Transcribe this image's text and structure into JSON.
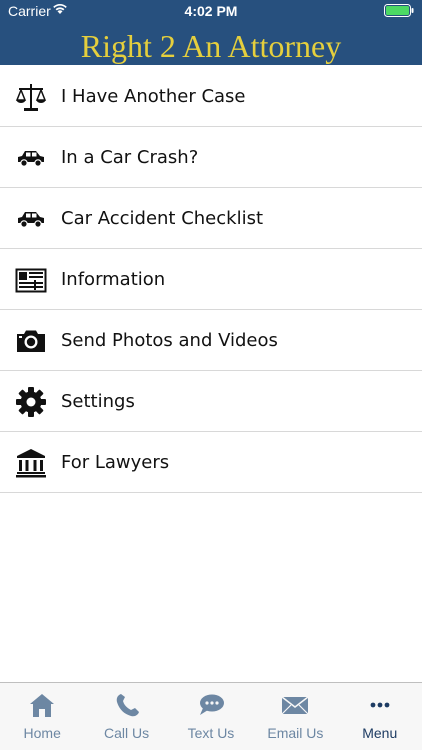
{
  "status_bar": {
    "carrier": "Carrier",
    "time": "4:02 PM",
    "icons": [
      "wifi-icon",
      "battery-icon"
    ]
  },
  "header": {
    "title": "Right 2 An Attorney"
  },
  "colors": {
    "header_bg": "#27507e",
    "title": "#e5cf3d",
    "tab_inactive": "#6d87a3",
    "tab_active": "#1e3c63",
    "battery": "#4cd964"
  },
  "menu": {
    "items": [
      {
        "label": "I Have Another Case",
        "icon": "scales-icon"
      },
      {
        "label": "In a Car Crash?",
        "icon": "car-icon"
      },
      {
        "label": "Car Accident Checklist",
        "icon": "car-icon"
      },
      {
        "label": "Information",
        "icon": "newspaper-icon"
      },
      {
        "label": "Send Photos and Videos",
        "icon": "camera-icon"
      },
      {
        "label": "Settings",
        "icon": "gear-icon"
      },
      {
        "label": "For Lawyers",
        "icon": "courthouse-icon"
      }
    ]
  },
  "tab_bar": {
    "tabs": [
      {
        "label": "Home",
        "icon": "home-icon"
      },
      {
        "label": "Call Us",
        "icon": "phone-icon"
      },
      {
        "label": "Text Us",
        "icon": "chat-icon"
      },
      {
        "label": "Email Us",
        "icon": "envelope-icon"
      },
      {
        "label": "Menu",
        "icon": "more-icon"
      }
    ],
    "active": "Menu"
  }
}
